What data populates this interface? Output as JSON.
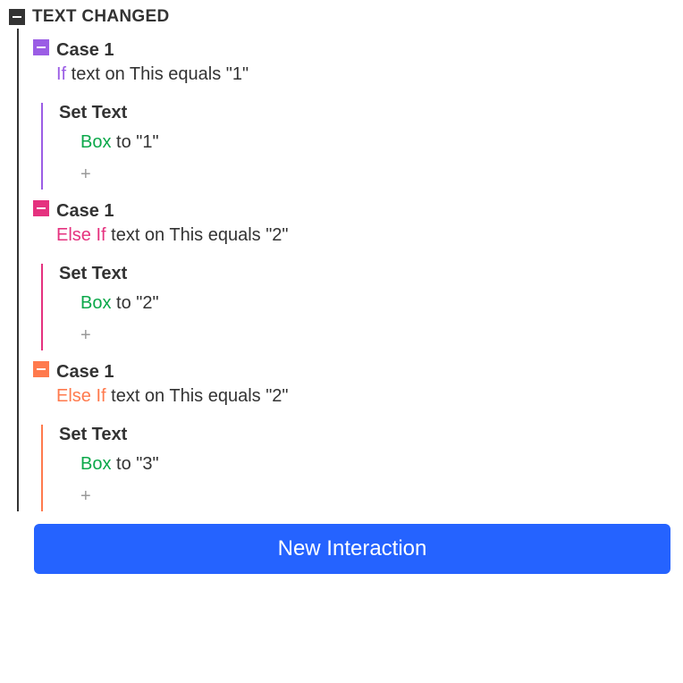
{
  "event": {
    "title": "TEXT CHANGED"
  },
  "cases": [
    {
      "title": "Case 1",
      "keyword": "If",
      "cond_rest": " text on This equals \"1\"",
      "action_title": "Set Text",
      "target": "Box",
      "target_rest": " to \"1\""
    },
    {
      "title": "Case 1",
      "keyword": "Else If",
      "cond_rest": " text on This equals \"2\"",
      "action_title": "Set Text",
      "target": "Box",
      "target_rest": " to \"2\""
    },
    {
      "title": "Case 1",
      "keyword": "Else If",
      "cond_rest": " text on This equals \"2\"",
      "action_title": "Set Text",
      "target": "Box",
      "target_rest": " to \"3\""
    }
  ],
  "button": {
    "label": "New Interaction"
  },
  "add_icon": "+"
}
